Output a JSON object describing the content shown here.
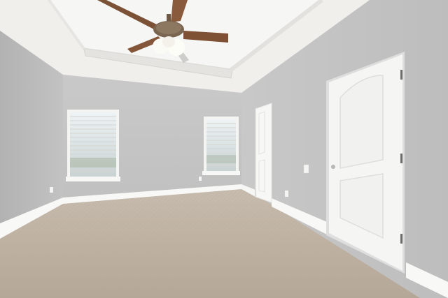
{
  "scene": {
    "palette": {
      "ceiling": "#f1f1ef",
      "tray_inner": "#f7f7f5",
      "wall_left": "#bcbcbc",
      "wall_back": "#c6c6c6",
      "wall_right": "#c4c4c4",
      "trim": "#fafafa",
      "carpet": "#bfb2a4",
      "door": "#f4f4f2",
      "fan_blade": "#8a5a3c",
      "window_sky": "#dfe8ee"
    },
    "icons": [
      "ceiling-fan-icon",
      "light-switch-icon",
      "outlet-icon",
      "door-handle-icon"
    ]
  }
}
